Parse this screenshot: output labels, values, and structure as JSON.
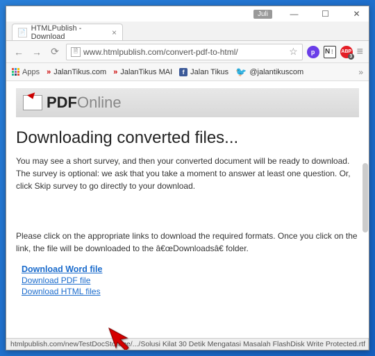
{
  "titlebar": {
    "user_label": "Juli"
  },
  "tab": {
    "title": "HTMLPublish - Download"
  },
  "urlbar": {
    "text": "www.htmlpublish.com/convert-pdf-to-html/"
  },
  "bookmarks": {
    "apps": "Apps",
    "item1": "JalanTikus.com",
    "item2": "JalanTikus MAI",
    "item3": "Jalan Tikus",
    "item4": "@jalantikuscom"
  },
  "page": {
    "logo_bold": "PDF",
    "logo_light": "Online",
    "heading": "Downloading converted files...",
    "para1": "You may see a short survey, and then your converted document will be ready to download. The survey is optional: we ask that you take a moment to answer at least one question. Or, click Skip survey to go directly to your download.",
    "para2": "Please click on the appropriate links to download the required formats. Once you click on the link, the file will be downloaded to the â€œDownloadsâ€ folder.",
    "link1": "Download Word file",
    "link2": "Download PDF file",
    "link3": "Download HTML files"
  },
  "status": "htmlpublish.com/newTestDocStorage/.../Solusi Kilat 30 Detik Mengatasi Masalah FlashDisk Write Protected.rtf"
}
